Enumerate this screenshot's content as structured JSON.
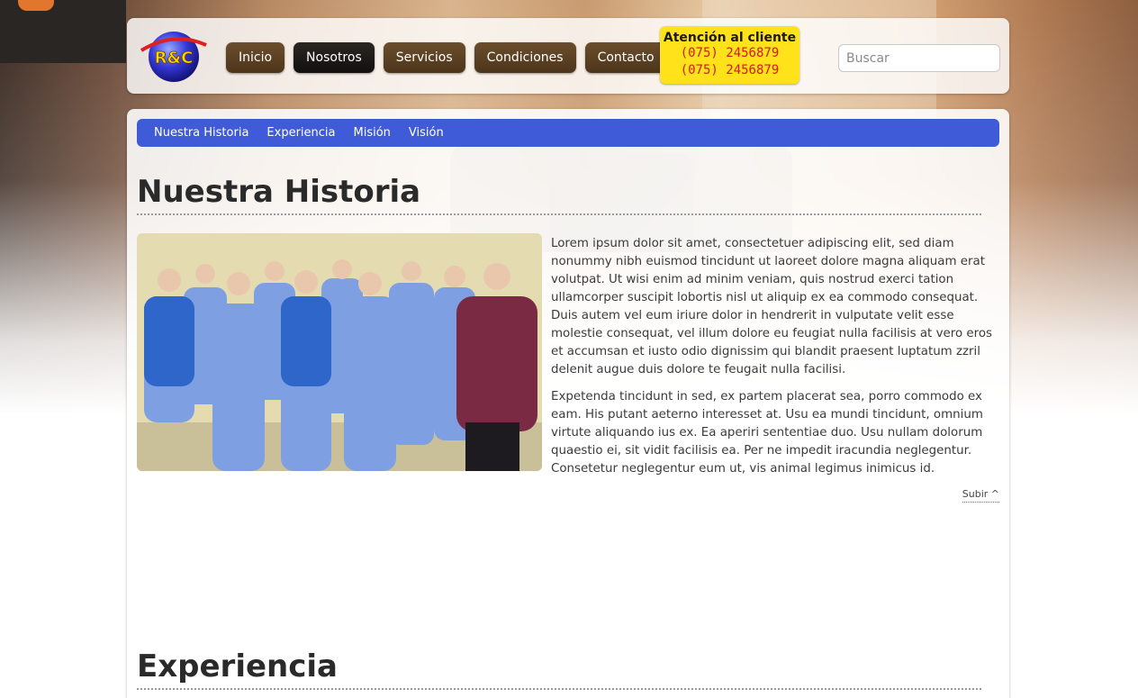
{
  "logo": {
    "text": "R&C"
  },
  "nav": [
    {
      "label": "Inicio",
      "active": false
    },
    {
      "label": "Nosotros",
      "active": true
    },
    {
      "label": "Servicios",
      "active": false
    },
    {
      "label": "Condiciones",
      "active": false
    },
    {
      "label": "Contacto",
      "active": false
    }
  ],
  "customer_service": {
    "title": "Atención al cliente",
    "phone1": "(075) 2456879",
    "phone2": "(075) 2456879"
  },
  "search": {
    "placeholder": "Buscar",
    "value": ""
  },
  "subnav": [
    {
      "label": "Nuestra Historia"
    },
    {
      "label": "Experiencia"
    },
    {
      "label": "Misión"
    },
    {
      "label": "Visión"
    }
  ],
  "sections": {
    "historia": {
      "title": "Nuestra Historia",
      "paragraphs": [
        "Lorem ipsum dolor sit amet, consectetuer adipiscing elit, sed diam nonummy nibh euismod tincidunt ut laoreet dolore magna aliquam erat volutpat. Ut wisi enim ad minim veniam, quis nostrud exerci tation ullamcorper suscipit lobortis nisl ut aliquip ex ea commodo consequat. Duis autem vel eum iriure dolor in hendrerit in vulputate velit esse molestie consequat, vel illum dolore eu feugiat nulla facilisis at vero eros et accumsan et iusto odio dignissim qui blandit praesent luptatum zzril delenit augue duis dolore te feugait nulla facilisi.",
        "Expetenda tincidunt in sed, ex partem placerat sea, porro commodo ex eam. His putant aeterno interesset at. Usu ea mundi tincidunt, omnium virtute aliquando ius ex. Ea aperiri sententiae duo. Usu nullam dolorum quaestio ei, sit vidit facilisis ea. Per ne impedit iracundia neglegentur. Consetetur neglegentur eum ut, vis animal legimus inimicus id."
      ],
      "back_to_top": "Subir ^"
    },
    "experiencia": {
      "title": "Experiencia"
    }
  },
  "colors": {
    "nav_button": "#5b4022",
    "nav_active": "#1b1815",
    "subnav": "#3f5bd8",
    "callout": "#ffe21a",
    "phone": "#d11a1a"
  }
}
